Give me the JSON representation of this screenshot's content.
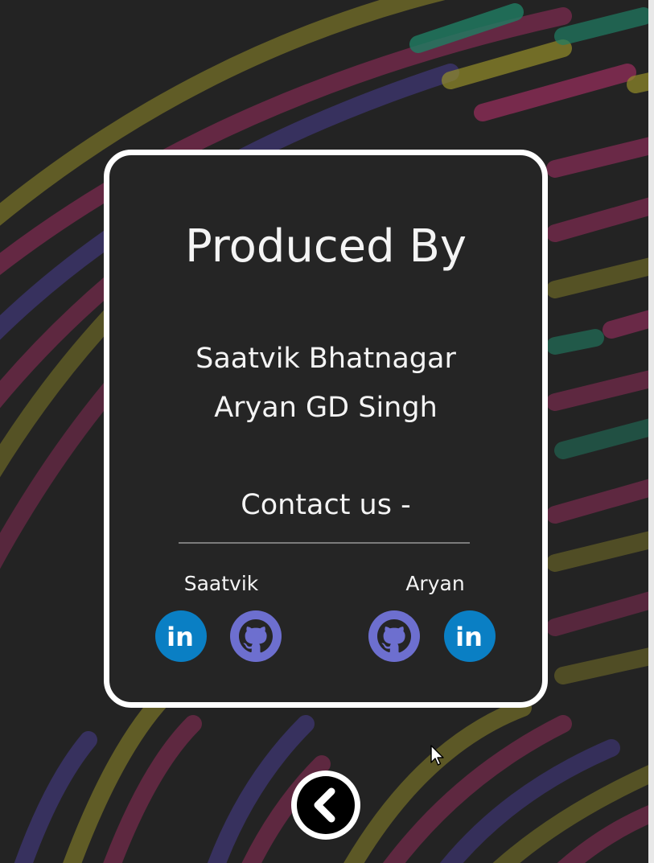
{
  "card": {
    "title": "Produced By",
    "producers": [
      "Saatvik Bhatnagar",
      "Aryan GD Singh"
    ],
    "contact_heading": "Contact us -"
  },
  "contacts": [
    {
      "label": "Saatvik",
      "links": [
        {
          "icon": "linkedin-icon"
        },
        {
          "icon": "github-icon"
        }
      ]
    },
    {
      "label": "Aryan",
      "links": [
        {
          "icon": "github-icon"
        },
        {
          "icon": "linkedin-icon"
        }
      ]
    }
  ],
  "colors": {
    "background": "#232323",
    "card": "#252525",
    "card_border": "#ffffff",
    "linkedin": "#0a7fc4",
    "github": "#6d6fcf",
    "stripe_pink": "#b0306a",
    "stripe_yellow": "#a9a12b",
    "stripe_teal": "#1f8e6f",
    "stripe_purple": "#4d3f9a"
  },
  "back_button": {
    "icon": "chevron-left-icon"
  }
}
